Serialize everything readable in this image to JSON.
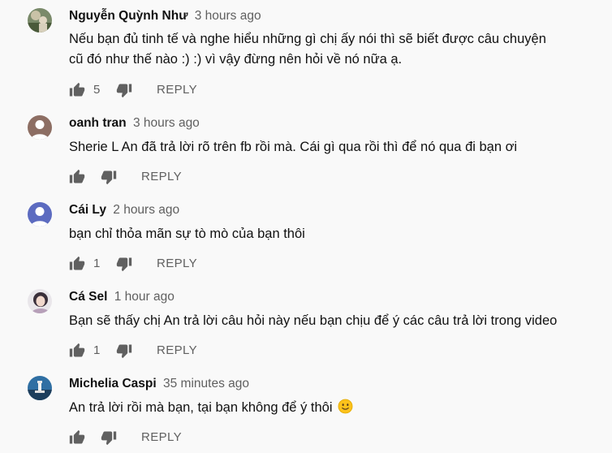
{
  "comments": [
    {
      "author": "Nguyễn Quỳnh Như",
      "time": "3 hours ago",
      "text_lines": [
        "Nếu bạn đủ tinh tế và nghe hiểu những gì chị ấy nói thì sẽ biết được câu chuyện",
        "cũ đó như thế nào :) :) vì vậy đừng nên hỏi về nó nữa ạ."
      ],
      "likes": "5",
      "reply_label": "REPLY"
    },
    {
      "author": "oanh tran",
      "time": "3 hours ago",
      "text_lines": [
        "Sherie L An đã trả lời rõ trên fb rồi mà. Cái gì qua rồi thì để nó qua đi bạn ơi"
      ],
      "likes": "",
      "reply_label": "REPLY"
    },
    {
      "author": "Cái Ly",
      "time": "2 hours ago",
      "text_lines": [
        "bạn chỉ thỏa mãn sự tò mò của bạn thôi"
      ],
      "likes": "1",
      "reply_label": "REPLY"
    },
    {
      "author": "Cá Sel",
      "time": "1 hour ago",
      "text_lines": [
        "Bạn sẽ thấy chị An trả lời câu hỏi này nếu bạn chịu để ý các câu trả lời trong video"
      ],
      "likes": "1",
      "reply_label": "REPLY"
    },
    {
      "author": "Michelia Caspi",
      "time": "35 minutes ago",
      "text_lines": [
        "An trả lời rồi mà bạn, tại bạn không để ý thôi"
      ],
      "emoji": "slightly-smiling-face",
      "likes": "",
      "reply_label": "REPLY"
    }
  ],
  "icons": {
    "like": "thumbs-up-icon",
    "dislike": "thumbs-down-icon"
  },
  "colors": {
    "background": "#f9f9f9",
    "text": "#111111",
    "secondary": "#606060",
    "icon": "#606060"
  }
}
